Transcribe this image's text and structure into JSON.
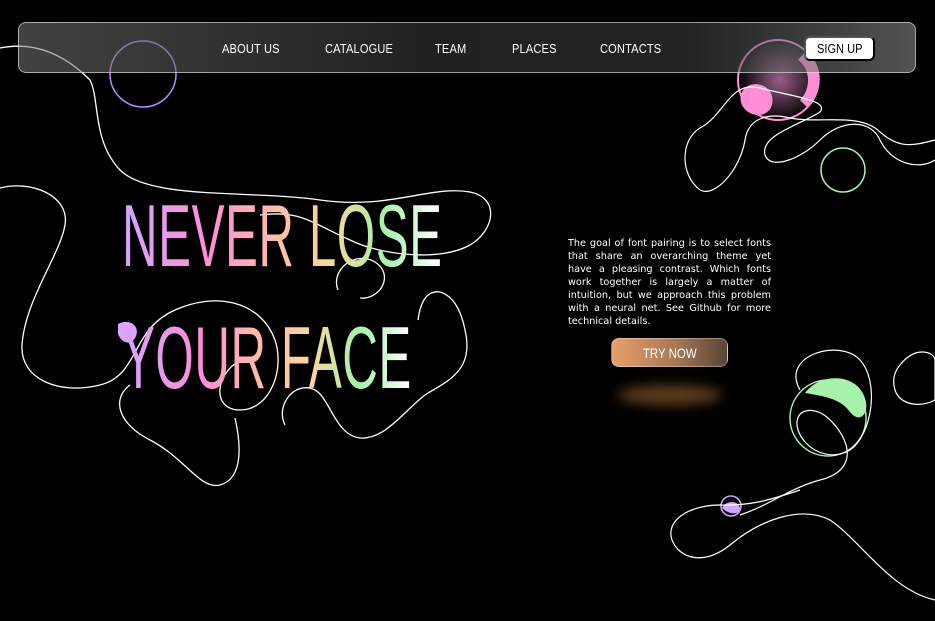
{
  "nav": {
    "items": [
      {
        "label": "ABOUT US"
      },
      {
        "label": "CATALOGUE"
      },
      {
        "label": "TEAM"
      },
      {
        "label": "PLACES"
      },
      {
        "label": "CONTACTS"
      }
    ],
    "signup_label": "SIGN UP"
  },
  "hero": {
    "headline_line1": "NEVER LOSE",
    "headline_line2": "YOUR FACE",
    "description": "The goal of font pairing is to select fonts that share an overarching theme yet have a pleasing contrast. Which fonts work together is largely a matter of intuition, but we approach this problem with a neural net. See Github for more technical details.",
    "cta_label": "TRY NOW"
  },
  "colors": {
    "background": "#000000",
    "gradient_purple": "#d3a5ff",
    "gradient_pink": "#ff8ed6",
    "gradient_peach": "#f9d79c",
    "gradient_green": "#a6f2ab",
    "cta_orange": "#e6a06c"
  }
}
